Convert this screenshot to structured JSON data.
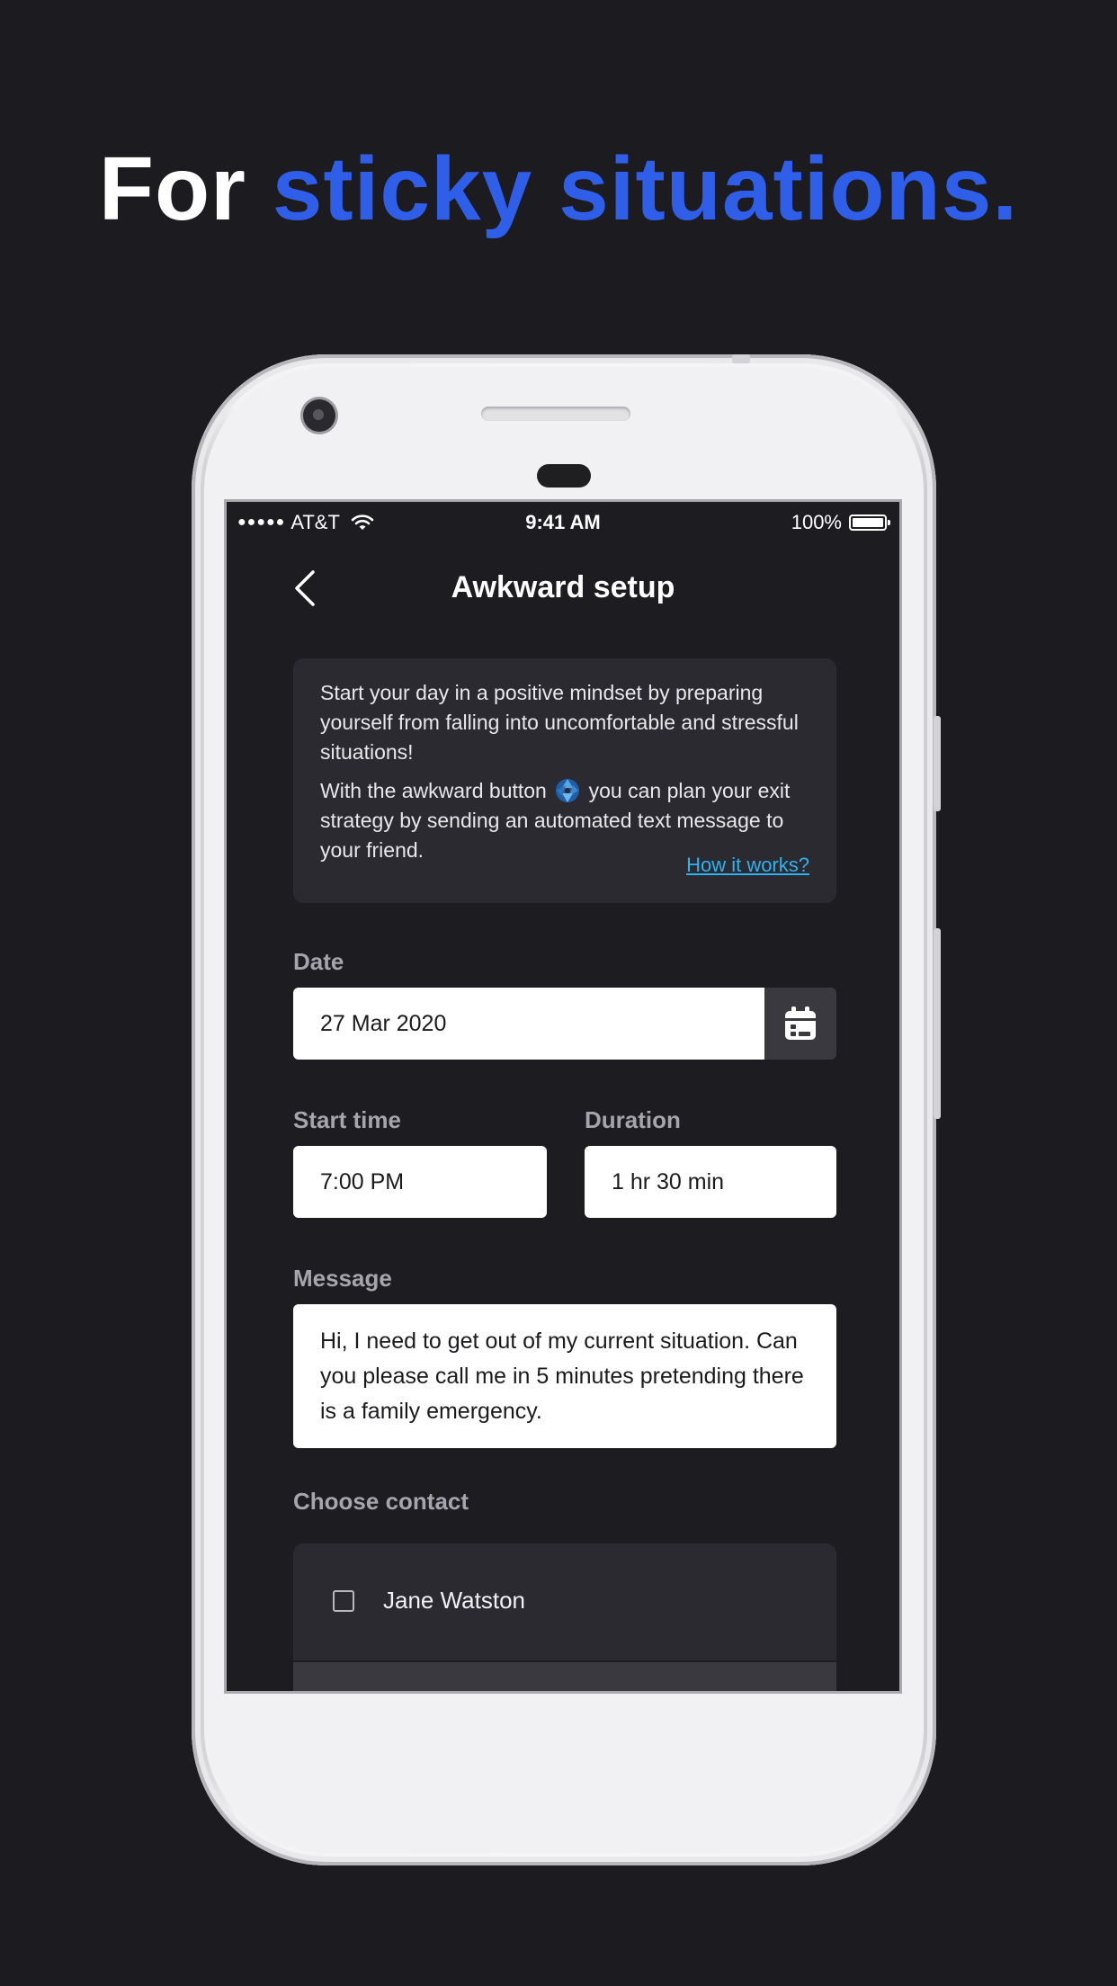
{
  "headline": {
    "part1": "For ",
    "part2": "sticky situations."
  },
  "status_bar": {
    "signal_dots": "●●●●●",
    "carrier": "AT&T",
    "time": "9:41 AM",
    "battery": "100%"
  },
  "nav": {
    "title": "Awkward setup"
  },
  "info": {
    "paragraph1": "Start your day in a positive mindset by preparing yourself from falling into uncomfortable and stressful situations!",
    "paragraph2_before": "With the awkward button",
    "paragraph2_after": "you can plan your exit strategy by sending an automated text message to your friend.",
    "link": "How it works?"
  },
  "form": {
    "date_label": "Date",
    "date_value": "27 Mar 2020",
    "start_time_label": "Start time",
    "start_time_value": "7:00 PM",
    "duration_label": "Duration",
    "duration_value": "1 hr 30 min",
    "message_label": "Message",
    "message_value": "Hi, I need to get out of my current situation. Can you please call me in 5 minutes pretending there is a family emergency.",
    "contact_label": "Choose contact"
  },
  "contacts": [
    {
      "name": "Jane Watston",
      "checked": false
    }
  ],
  "colors": {
    "background": "#1c1b20",
    "accent": "#2f5ee8",
    "link": "#2fb2f0",
    "card": "#2b2a30"
  }
}
